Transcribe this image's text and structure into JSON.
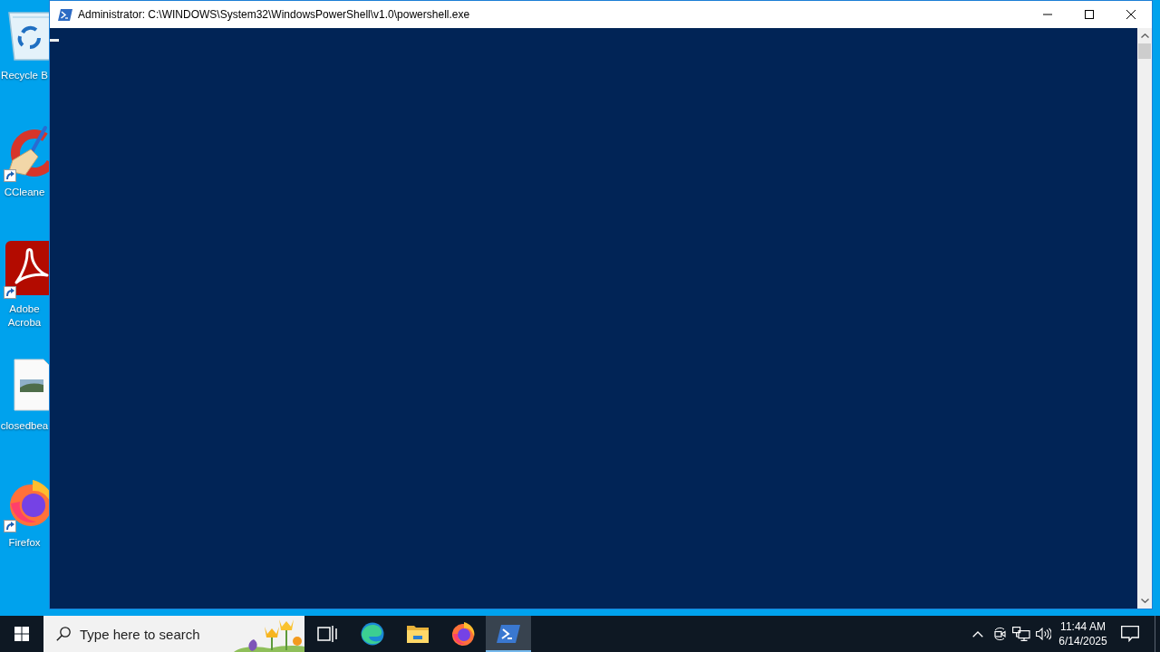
{
  "desktop": {
    "icons": [
      {
        "kind": "recycle-bin",
        "label": "Recycle B",
        "shortcut": false
      },
      {
        "kind": "cleaner",
        "label": "CCleane",
        "shortcut": true
      },
      {
        "kind": "pdf-reader",
        "label": "Adobe Acroba",
        "shortcut": true
      },
      {
        "kind": "image-file",
        "label": "closedbea",
        "shortcut": false
      },
      {
        "kind": "firefox",
        "label": "Firefox",
        "shortcut": true
      }
    ]
  },
  "window": {
    "title": "Administrator: C:\\WINDOWS\\System32\\WindowsPowerShell\\v1.0\\powershell.exe"
  },
  "taskbar": {
    "search": {
      "placeholder": "Type here to search"
    },
    "buttons": [
      {
        "kind": "task-view",
        "selected": false
      },
      {
        "kind": "edge",
        "selected": false
      },
      {
        "kind": "file-explorer",
        "selected": false
      },
      {
        "kind": "firefox",
        "selected": false
      },
      {
        "kind": "powershell",
        "selected": true
      }
    ],
    "clock": {
      "time": "11:44 AM",
      "date": "6/14/2025"
    }
  }
}
